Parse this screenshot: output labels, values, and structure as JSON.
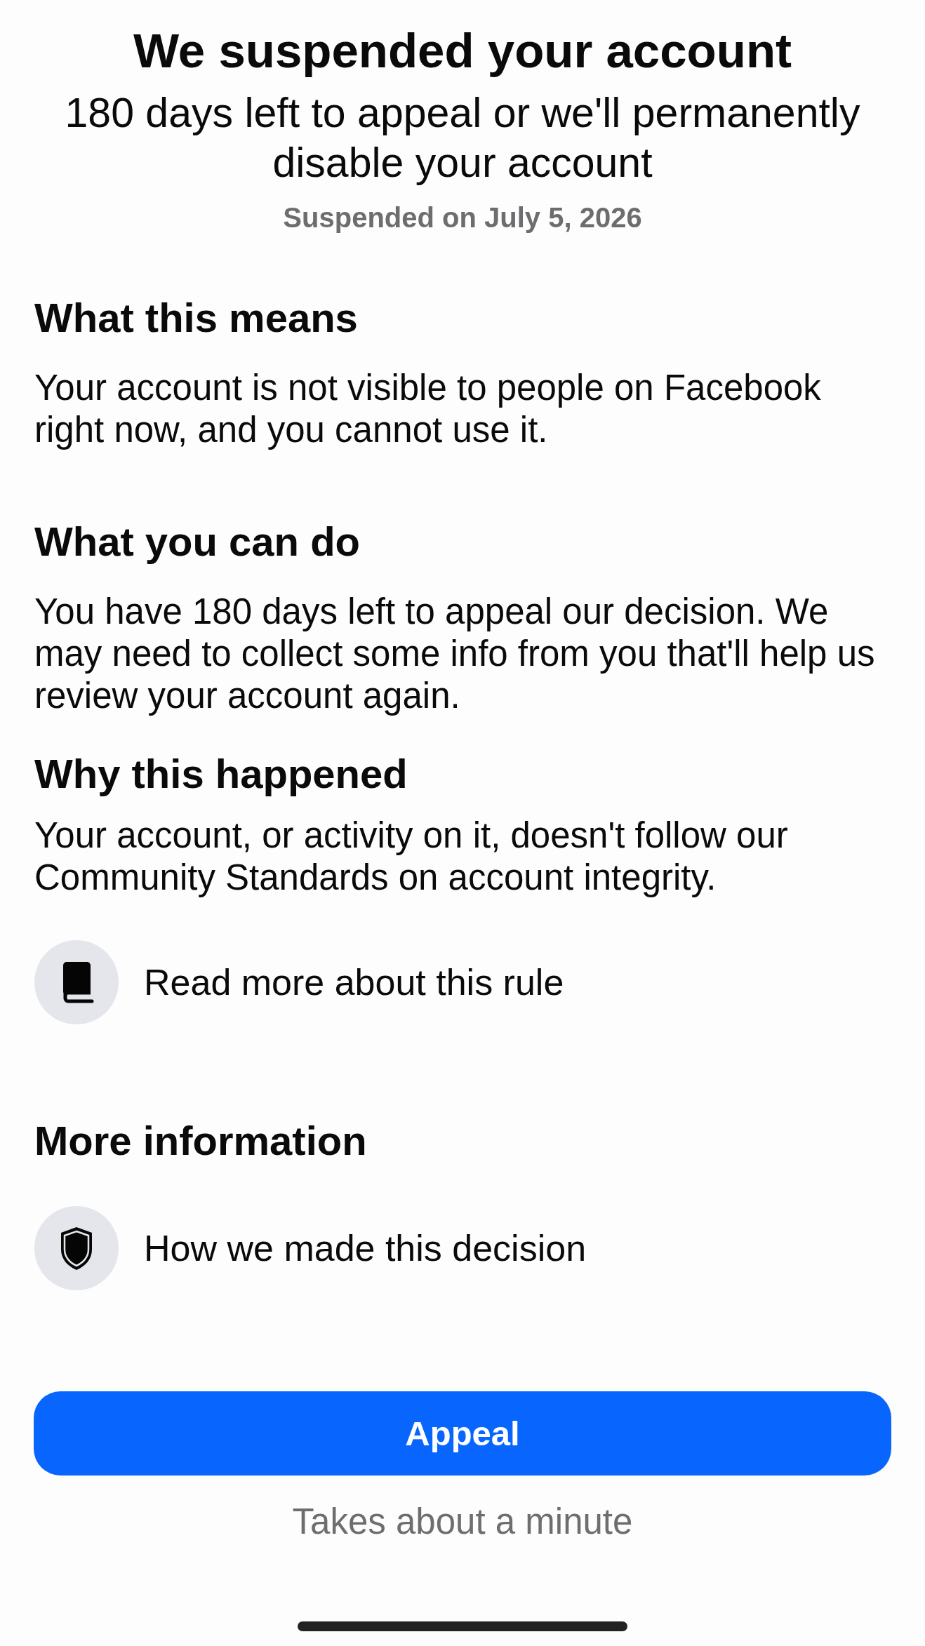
{
  "header": {
    "title": "We suspended your account",
    "subtitle": "180 days left to appeal or we'll permanently disable your account",
    "date": "Suspended on July 5, 2026"
  },
  "sections": [
    {
      "heading": "What this means",
      "body": "Your account is not visible to people on Facebook right now, and you cannot use it."
    },
    {
      "heading": "What you can do",
      "body": "You have 180 days left to appeal our decision. We may need to collect some info from you that'll help us review your account again."
    },
    {
      "heading": "Why this happened",
      "body": "Your account, or activity on it, doesn't follow our Community Standards on account integrity.",
      "link": {
        "kind": "rule",
        "label": "Read more about this rule"
      }
    },
    {
      "heading": "More information",
      "link": {
        "kind": "decision",
        "label": "How we made this decision"
      }
    }
  ],
  "footer": {
    "button": "Appeal",
    "note": "Takes about a minute"
  }
}
